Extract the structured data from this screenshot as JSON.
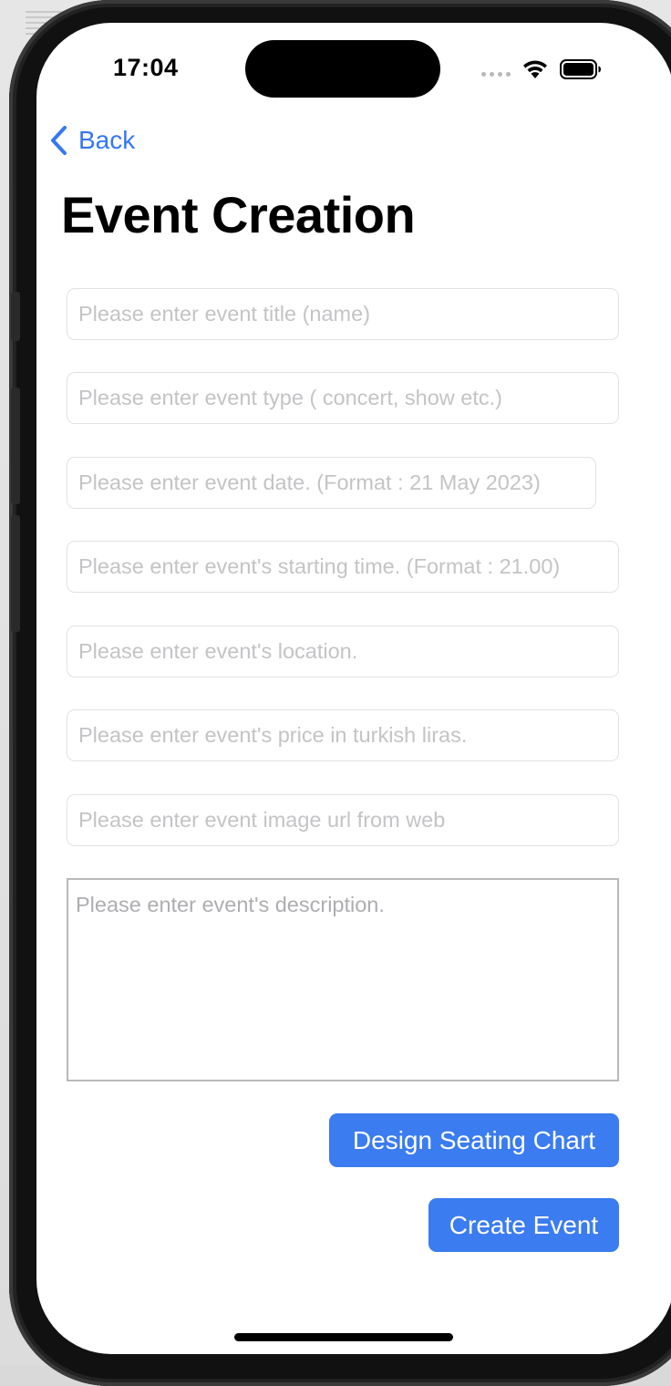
{
  "status_bar": {
    "time": "17:04",
    "icons": [
      "cellular-dots-icon",
      "wifi-icon",
      "battery-icon"
    ]
  },
  "nav": {
    "back_label": "Back",
    "back_icon": "chevron-left-icon",
    "accent_color": "#3478f6"
  },
  "page": {
    "title": "Event Creation"
  },
  "form": {
    "title_placeholder": "Please enter event title (name)",
    "type_placeholder": "Please enter event type ( concert, show etc.)",
    "date_placeholder": "Please enter event date. (Format : 21 May 2023)",
    "time_placeholder": "Please enter event's starting time. (Format : 21.00)",
    "location_placeholder": "Please enter event's location.",
    "price_placeholder": "Please enter event's price in turkish liras.",
    "image_url_placeholder": "Please enter event image url from web",
    "description_placeholder": "Please enter event's description."
  },
  "actions": {
    "design_seating_label": "Design Seating Chart",
    "create_event_label": "Create Event",
    "button_color": "#3b7cf0"
  }
}
